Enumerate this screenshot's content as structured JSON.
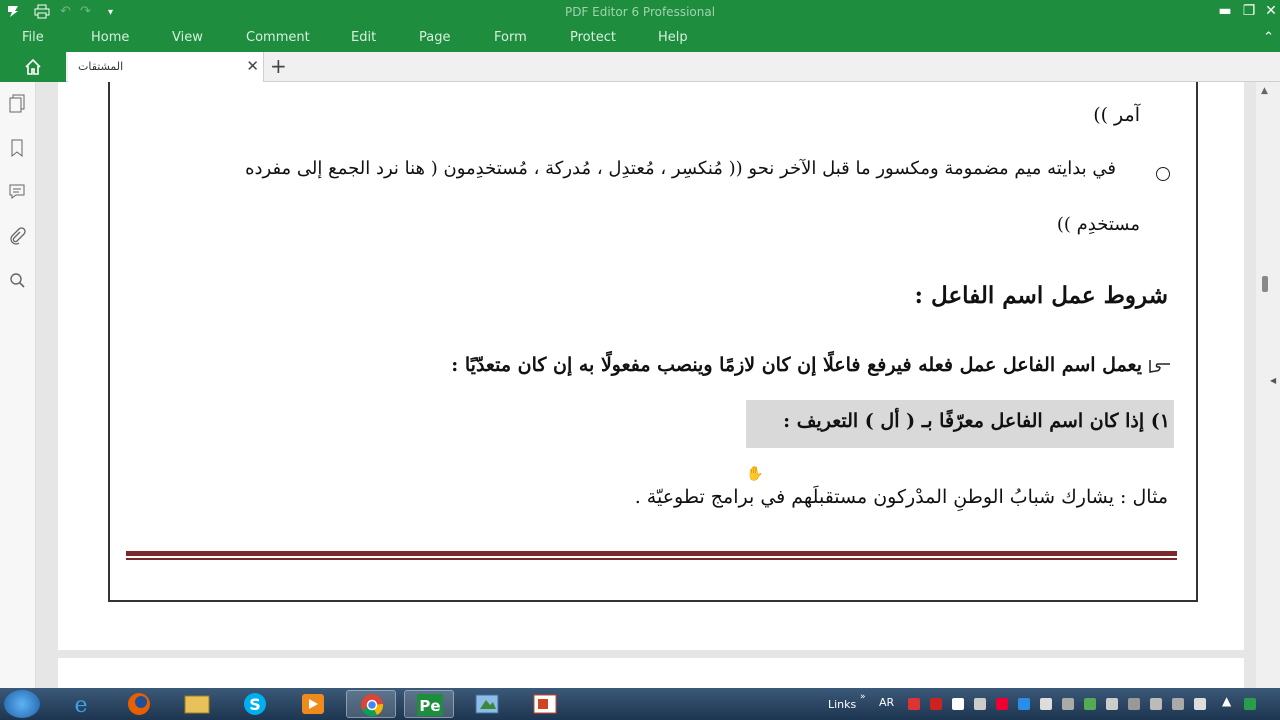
{
  "app": {
    "title": "PDF Editor 6 Professional",
    "quick_access": [
      "save-icon",
      "print-icon",
      "undo-icon",
      "redo-icon",
      "customize-icon"
    ],
    "window_controls": {
      "minimize": "▬",
      "restore": "❐",
      "close": "✕"
    }
  },
  "menu": {
    "items": [
      "File",
      "Home",
      "View",
      "Comment",
      "Edit",
      "Page",
      "Form",
      "Protect",
      "Help"
    ],
    "collapse": "⌃"
  },
  "tabs": {
    "doc_tab_label": "المشتقات",
    "close": "✕",
    "add": "+"
  },
  "sidebar": {
    "icons": [
      "pages-icon",
      "bookmark-icon",
      "comments-icon",
      "attachment-icon",
      "search-icon"
    ]
  },
  "document": {
    "line_amir": "آمر ))",
    "line_bullet": "في بدايته ميم مضمومة ومكسور ما قبل الآخر نحو  (( مُنكسِر ، مُعتدِل ، مُدركة ، مُستخدِمون ( هنا نرد الجمع إلى مفرده",
    "line_mustakhdim": "مستخدِم ))",
    "heading": "شروط عمل اسم الفاعل :",
    "rule_text": "يعمل اسم الفاعل عمل فعله فيرفع فاعلًا إن كان لازمًا وينصب مفعولًا به إن كان متعدّيًا :",
    "case1": "١) إذا كان اسم الفاعل معرّفًا بـ ( أل ) التعريف :",
    "example": "مثال : يشارك شبابُ الوطنِ المدْركون مستقبلَهم في برامج تطوعيّة ."
  },
  "taskbar": {
    "apps": [
      "start-orb",
      "internet-explorer",
      "firefox",
      "file-explorer",
      "skype",
      "media-player",
      "chrome",
      "pdf-editor",
      "paint",
      "powerpoint"
    ],
    "links_label": "Links",
    "lang": "AR",
    "colors": {
      "taskbar": "#1d3550",
      "accent_green": "#1e8e3e"
    }
  }
}
